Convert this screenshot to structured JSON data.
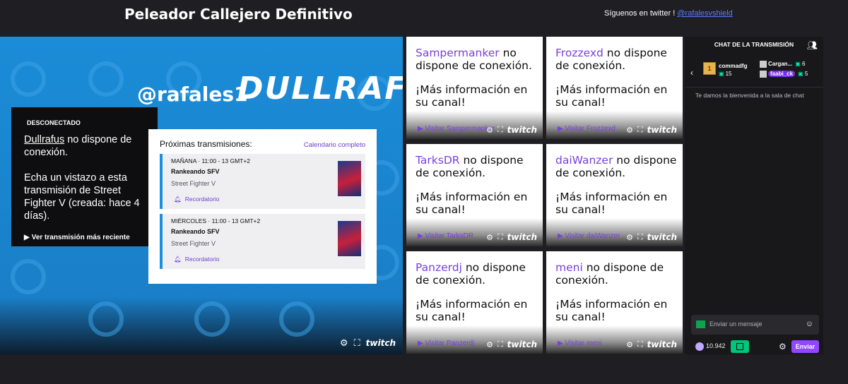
{
  "header": {
    "title": "Peleador Callejero Definitivo",
    "follow_text": "Síguenos en twitter ! ",
    "follow_link": "@rafalesvshield"
  },
  "main_player": {
    "banner_handle": "@rafales1",
    "banner_name": "DULLRAF",
    "offline_badge": "DESCONECTADO",
    "channel": "Dullrafus",
    "offline_suffix": " no dispone de conexión.",
    "vod_text": "Echa un vistazo a esta transmisión de Street Fighter V (creada: hace 4 días).",
    "watch_recent": "Ver transmisión más reciente",
    "schedule": {
      "title": "Próximas transmisiones:",
      "calendar_link": "Calendario completo",
      "items": [
        {
          "when": "MAÑANA  ·  11:00 - 13 GMT+2",
          "title": "Rankeando SFV",
          "game": "Street Fighter V",
          "remind": "Recordatorio"
        },
        {
          "when": "MIÉRCOLES  ·  11:00 - 13 GMT+2",
          "title": "Rankeando SFV",
          "game": "Street Fighter V",
          "remind": "Recordatorio"
        }
      ]
    },
    "brand": "twitch"
  },
  "tiles": [
    {
      "name": "Sampermanker",
      "offline": " no dispone de conexión.",
      "more": "¡Más información en su canal!",
      "visit": "Visitar Sampermanker"
    },
    {
      "name": "Frozzexd",
      "offline": " no dispone de conexión.",
      "more": "¡Más información en su canal!",
      "visit": "Visitar Frozzexd"
    },
    {
      "name": "TarksDR",
      "offline": " no dispone de conexión.",
      "more": "¡Más información en su canal!",
      "visit": "Visitar TarksDR"
    },
    {
      "name": "daiWanzer",
      "offline": " no dispone de conexión.",
      "more": "¡Más información en su canal!",
      "visit": "Visitar daiWanzer"
    },
    {
      "name": "Panzerdj",
      "offline": " no dispone de conexión.",
      "more": "¡Más información en su canal!",
      "visit": "Visitar Panzerdj"
    },
    {
      "name": "meni",
      "offline": " no dispone de conexión.",
      "more": "¡Más información en su canal!",
      "visit": "Visitar meni"
    }
  ],
  "chat": {
    "title": "CHAT DE LA TRANSMISIÓN",
    "gifters": [
      {
        "name": "commadfg",
        "count": "15",
        "box_label": "1"
      },
      {
        "name": "Cargan...",
        "count": "6"
      },
      {
        "name": "faabi_ck",
        "count": "5"
      }
    ],
    "welcome": "Te damos la bienvenida a la sala de chat",
    "input_placeholder": "Enviar un mensaje",
    "points": "10.942",
    "send_label": "Enviar"
  },
  "colors": {
    "accent": "#9147ff",
    "channel_name": "#7a3fe0",
    "player_bg": "#1b8cd8",
    "schedule_bar": "#1a8fe0"
  }
}
